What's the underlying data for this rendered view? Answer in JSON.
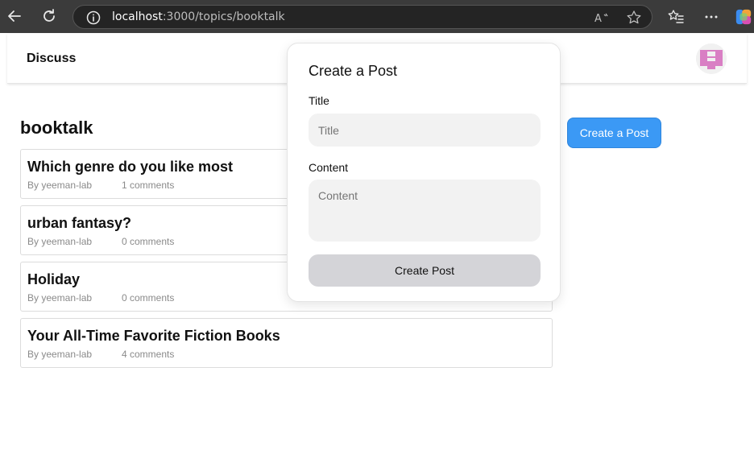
{
  "browser": {
    "url_host": "localhost",
    "url_rest": ":3000/topics/booktalk"
  },
  "header": {
    "brand": "Discuss"
  },
  "topic": {
    "title": "booktalk",
    "create_button": "Create a Post"
  },
  "posts": [
    {
      "title": "Which genre do you like most",
      "author": "By yeeman-lab",
      "comments": "1 comments"
    },
    {
      "title": "urban fantasy?",
      "author": "By yeeman-lab",
      "comments": "0 comments"
    },
    {
      "title": "Holiday",
      "author": "By yeeman-lab",
      "comments": "0 comments"
    },
    {
      "title": "Your All-Time Favorite Fiction Books",
      "author": "By yeeman-lab",
      "comments": "4 comments"
    }
  ],
  "popover": {
    "heading": "Create a Post",
    "title_label": "Title",
    "title_placeholder": "Title",
    "content_label": "Content",
    "content_placeholder": "Content",
    "submit_label": "Create Post"
  },
  "colors": {
    "accent": "#3b99f5",
    "avatar": "#d97fc4"
  }
}
